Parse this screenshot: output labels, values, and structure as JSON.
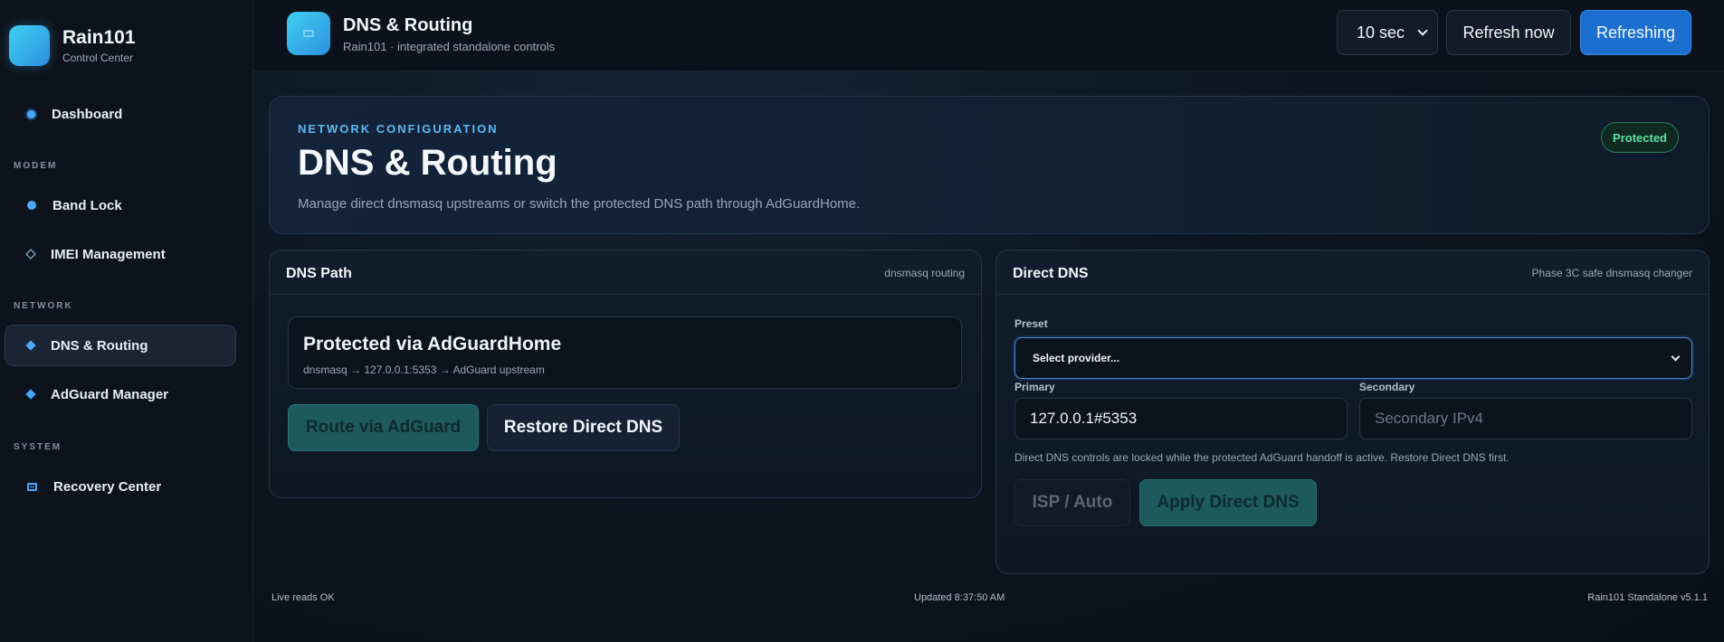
{
  "brand": {
    "title": "Rain101",
    "subtitle": "Control Center"
  },
  "sidebar": {
    "items": [
      {
        "label": "Dashboard",
        "icon": "dot-icon"
      },
      {
        "label": "Band Lock",
        "icon": "info-icon"
      },
      {
        "label": "IMEI Management",
        "icon": "diamond-outline-icon"
      },
      {
        "label": "DNS & Routing",
        "icon": "diamond-icon",
        "active": true
      },
      {
        "label": "AdGuard Manager",
        "icon": "diamond-icon"
      },
      {
        "label": "Recovery Center",
        "icon": "window-icon"
      }
    ],
    "sections": [
      "MODEM",
      "NETWORK",
      "SYSTEM"
    ]
  },
  "topbar": {
    "title": "DNS & Routing",
    "subtitle": "Rain101 · integrated standalone controls",
    "interval": "10 sec",
    "refresh_label": "Refresh now",
    "refreshing_label": "Refreshing"
  },
  "hero": {
    "eyebrow": "NETWORK CONFIGURATION",
    "title": "DNS & Routing",
    "description": "Manage direct dnsmasq upstreams or switch the protected DNS path through AdGuardHome.",
    "badge": "Protected"
  },
  "dns_path": {
    "title": "DNS Path",
    "meta": "dnsmasq routing",
    "status_title": "Protected via AdGuardHome",
    "status_detail": "dnsmasq → 127.0.0.1:5353 → AdGuard upstream",
    "route_label": "Route via AdGuard",
    "restore_label": "Restore Direct DNS"
  },
  "direct_dns": {
    "title": "Direct DNS",
    "meta": "Phase 3C safe dnsmasq changer",
    "preset_label": "Preset",
    "preset_value": "Select provider...",
    "primary_label": "Primary",
    "primary_value": "127.0.0.1#5353",
    "secondary_label": "Secondary",
    "secondary_placeholder": "Secondary IPv4",
    "note": "Direct DNS controls are locked while the protected AdGuard handoff is active. Restore Direct DNS first.",
    "isp_label": "ISP / Auto",
    "apply_label": "Apply Direct DNS"
  },
  "footer": {
    "left": "Live reads OK",
    "center": "Updated 8:37:50 AM",
    "right": "Rain101 Standalone v5.1.1"
  },
  "colors": {
    "accent": "#1d6fcf",
    "protected": "#5fe3a4",
    "teal_button": "#1c5a5e"
  }
}
